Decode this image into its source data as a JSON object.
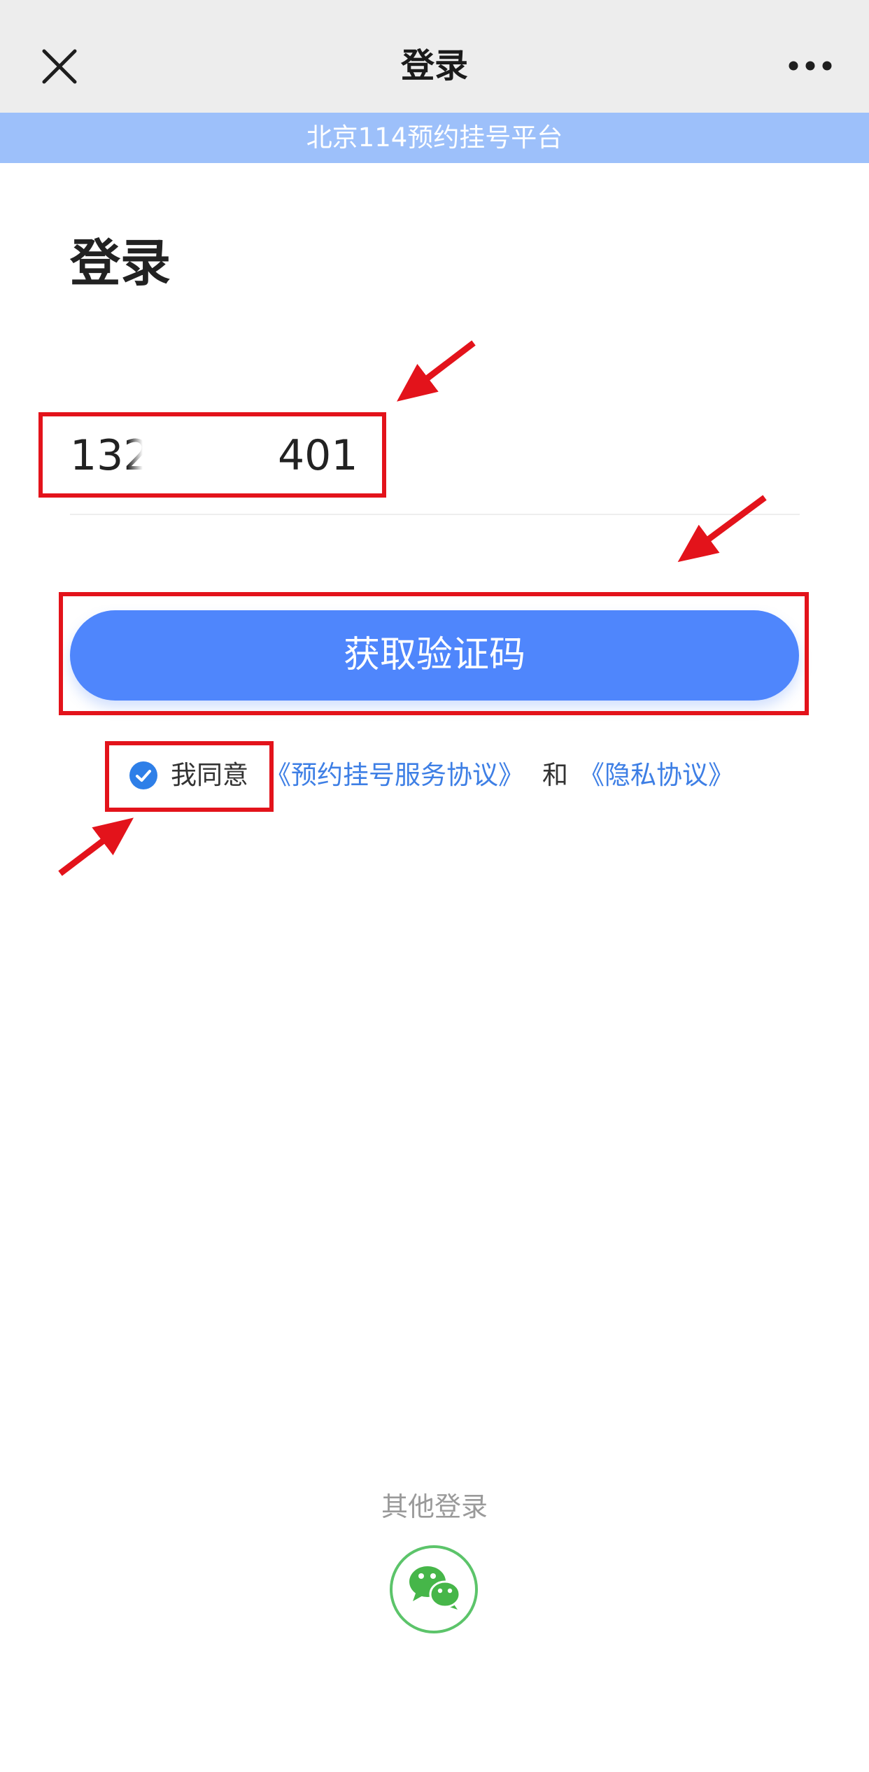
{
  "nav": {
    "title": "登录",
    "close_icon": "close-icon",
    "more_icon": "more-icon"
  },
  "banner": {
    "text": "北京114预约挂号平台"
  },
  "page": {
    "heading": "登录"
  },
  "form": {
    "phone_prefix": "132",
    "phone_suffix": "401",
    "submit_label": "获取验证码"
  },
  "agreement": {
    "checked": true,
    "checkbox_icon": "check-circle-icon",
    "agree_text": "我同意",
    "service_link": "《预约挂号服务协议》",
    "and_text": "和",
    "privacy_link": "《隐私协议》"
  },
  "other_login": {
    "label": "其他登录",
    "wechat_icon": "wechat-icon"
  },
  "annotations": {
    "arrow_icon": "red-arrow-icon"
  },
  "colors": {
    "nav_bg": "#ededed",
    "banner_blue": "#9dc0fa",
    "primary_blue": "#4f86fc",
    "link_blue": "#3e7fe5",
    "checkbox_blue": "#2e7fe8",
    "wechat_green": "#46b649",
    "annotation_red": "#e3131b"
  }
}
